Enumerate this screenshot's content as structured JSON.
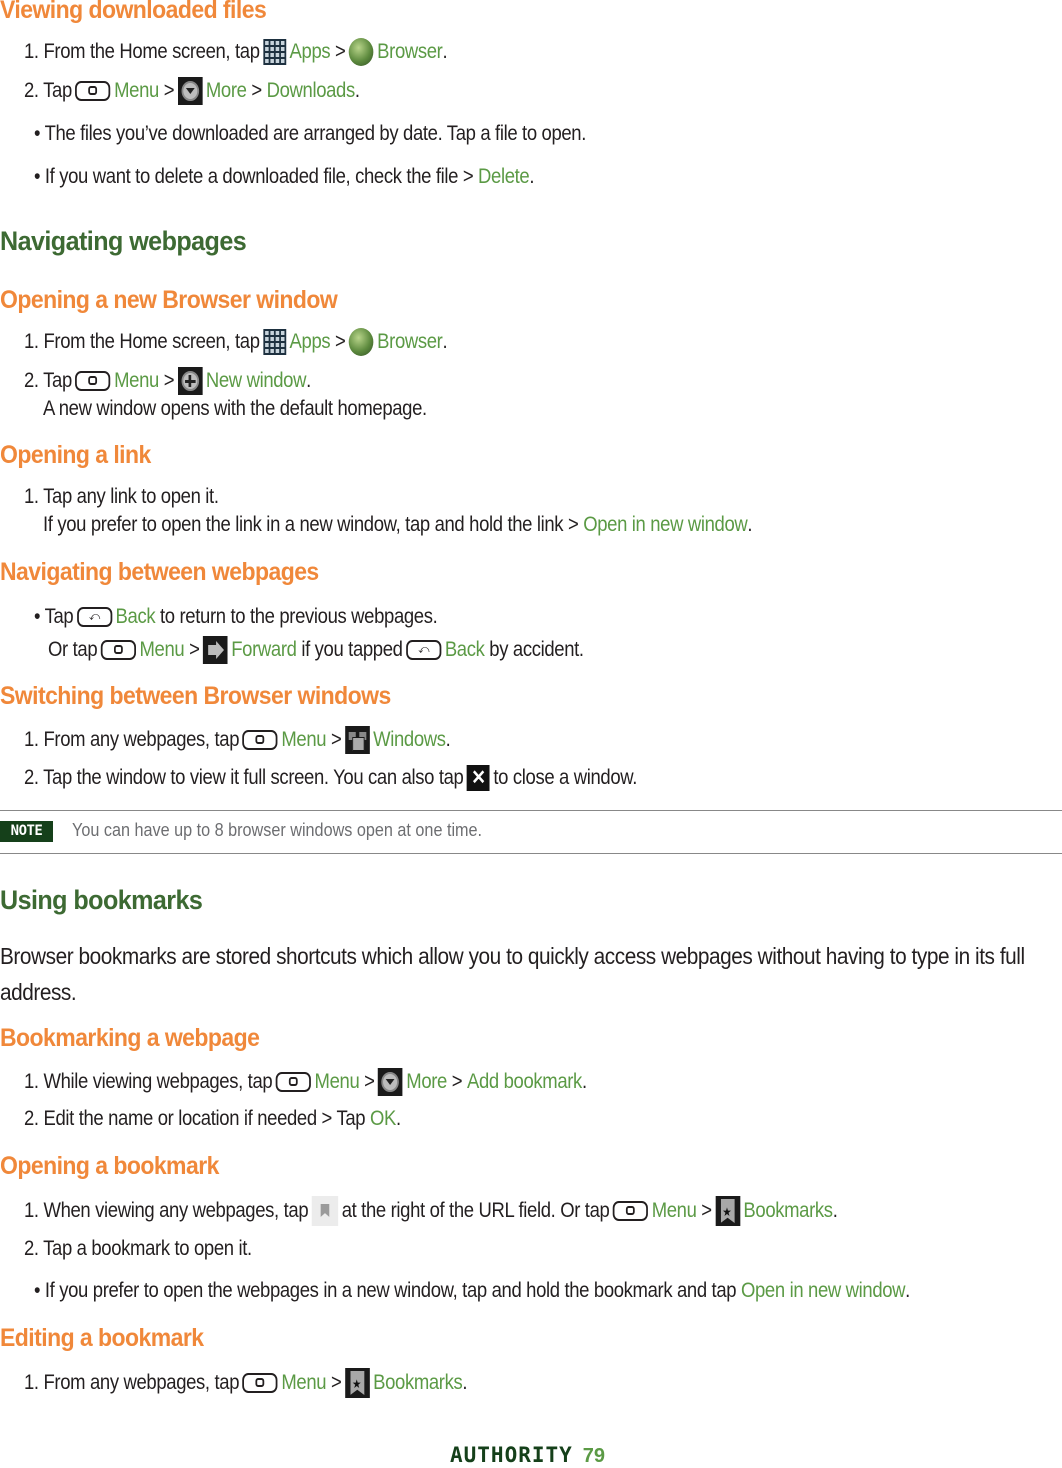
{
  "sections": {
    "viewing_downloads": {
      "title": "Viewing downloaded files",
      "step1": {
        "prefix": "1. From the Home screen, tap",
        "apps": "Apps",
        "sep": ">",
        "browser": "Browser",
        "end": "."
      },
      "step2": {
        "prefix": "2. Tap",
        "menu": "Menu",
        "sep1": ">",
        "more": "More",
        "sep2": ">",
        "downloads": "Downloads",
        "end": "."
      },
      "bullet1": "• The files you’ve downloaded are arranged by date. Tap a file to open.",
      "bullet2": {
        "text": "• If you want to delete a downloaded file, check the file >",
        "action": "Delete",
        "end": "."
      }
    },
    "navigating": {
      "title": "Navigating webpages"
    },
    "new_window": {
      "title": "Opening a new Browser window",
      "step1": {
        "prefix": "1. From the Home screen, tap",
        "apps": "Apps",
        "sep": ">",
        "browser": "Browser",
        "end": "."
      },
      "step2": {
        "prefix": "2. Tap",
        "menu": "Menu",
        "sep": ">",
        "new_window": "New window",
        "end": "."
      },
      "note": "A new window opens with the default homepage."
    },
    "open_link": {
      "title": "Opening a link",
      "step1": "1. Tap any link to open it.",
      "detail": {
        "text": "If you prefer to open the link in a new window, tap and hold the link >",
        "action": "Open in new window",
        "end": "."
      }
    },
    "between_pages": {
      "title": "Navigating between webpages",
      "bullet": {
        "prefix": "• Tap",
        "back": "Back",
        "rest": "to return to the previous webpages."
      },
      "or_line": {
        "prefix": "Or tap",
        "menu": "Menu",
        "sep": ">",
        "forward": "Forward",
        "mid": "if you tapped",
        "back": "Back",
        "end": "by accident."
      }
    },
    "switching": {
      "title": "Switching between Browser windows",
      "step1": {
        "prefix": "1. From any webpages, tap",
        "menu": "Menu",
        "sep": ">",
        "windows": "Windows",
        "end": "."
      },
      "step2": {
        "prefix": "2. Tap the window to view it full screen. You can also tap",
        "end": "to close a window."
      }
    },
    "note": {
      "badge": "NOTE",
      "text": "You can have up to 8 browser windows open at one time."
    },
    "bookmarks": {
      "title": "Using bookmarks",
      "intro": "Browser bookmarks are stored shortcuts which allow you to quickly access webpages without having to type in its full address."
    },
    "bookmarking": {
      "title": "Bookmarking a webpage",
      "step1": {
        "prefix": "1. While viewing webpages, tap",
        "menu": "Menu",
        "sep1": ">",
        "more": "More",
        "sep2": ">",
        "add": "Add bookmark",
        "end": "."
      },
      "step2": {
        "prefix": "2. Edit the name or location if needed > Tap",
        "ok": "OK",
        "end": "."
      }
    },
    "open_bookmark": {
      "title": "Opening a bookmark",
      "step1": {
        "prefix": "1. When viewing any webpages, tap",
        "mid": "at the right of the URL field. Or tap",
        "menu": "Menu",
        "sep": ">",
        "bookmarks": "Bookmarks",
        "end": "."
      },
      "step2": "2. Tap a bookmark to open it.",
      "bullet": {
        "text": "• If you prefer to open the webpages in a new window, tap and hold the bookmark and tap",
        "action": "Open in new window",
        "end": "."
      }
    },
    "edit_bookmark": {
      "title": "Editing a bookmark",
      "step1": {
        "prefix": "1. From any webpages, tap",
        "menu": "Menu",
        "sep": ">",
        "bookmarks": "Bookmarks",
        "end": "."
      }
    }
  },
  "footer": {
    "brand": "AUTHORITY",
    "page": "79"
  },
  "colors": {
    "heading_green": "#3d6a33",
    "subheading_orange": "#f0883a",
    "link_green": "#5b9a45",
    "note_badge": "#15401a"
  }
}
